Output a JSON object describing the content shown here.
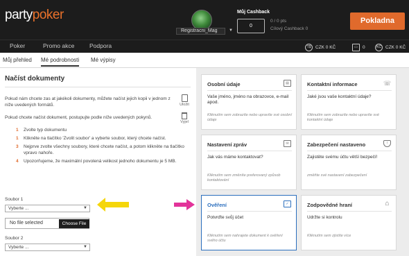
{
  "header": {
    "logo_main": "party",
    "logo_accent": "poker",
    "username": "Registracni_Mag",
    "cashback_title": "Můj Cashback",
    "cashback_value": "0",
    "cashback_pts": "0 / 0 pts",
    "cashback_total": "Cílový Cashback 0",
    "cashier_label": "Pokladna"
  },
  "nav": {
    "items": [
      "Poker",
      "Promo akce",
      "Podpora"
    ],
    "balances": [
      {
        "icon": "T$",
        "label": "CZK 0 KČ"
      },
      {
        "icon": "▭",
        "label": "0"
      },
      {
        "icon": "KČ",
        "label": "CZK 0 KČ"
      }
    ]
  },
  "subtabs": [
    "Můj přehled",
    "Mé podrobnosti",
    "Mé výpisy"
  ],
  "left": {
    "title": "Načíst dokumenty",
    "intro": "Pokud nám chcete zas at jakékoli dokumenty, můžete načíst jejich kopii v jednom z níže uvedených formátů.",
    "intro2": "Pokud chcete načíst dokument, postupujte podle níže uvedených pokynů.",
    "upload_label": "Uložit",
    "delete_label": "Vyjel",
    "steps": [
      {
        "num": "1",
        "text": "Zvolte typ dokumentu"
      },
      {
        "num": "1",
        "text": "Klikněte na tlačítko 'Zvolit soubor' a vyberte soubor, který chcete načíst."
      },
      {
        "num": "3",
        "text": "Nejprve zvolte všechny soubory, které chcete načíst, a potom klikněte na tlačítko vpravo nahoře."
      },
      {
        "num": "4",
        "text": "Upozorňujeme, že maximální povolená velikost jednoho dokumentu je 5 MB."
      }
    ],
    "file1_label": "Soubor 1",
    "file1_select": "Vyberte ...",
    "file_status": "No file selected",
    "choose_file": "Choose File",
    "file2_label": "Soubor 2",
    "file2_select": "Vyberte ..."
  },
  "cards": [
    {
      "title": "Osobní údaje",
      "icon": "id-card-icon",
      "body": "Vaše jméno, jméno na obrazovce, e-mail apod.",
      "hint": "Kliknutím sem zobrazíte nebo upravíte své osobní údaje"
    },
    {
      "title": "Kontaktní informace",
      "icon": "phone-icon",
      "body": "Jaké jsou vaše kontaktní údaje?",
      "hint": "Kliknutím sem zobrazíte nebo upravíte své kontaktní údaje"
    },
    {
      "title": "Nastavení zpráv",
      "icon": "message-settings-icon",
      "body": "Jak vás máme kontaktovat?",
      "hint": "Kliknutím sem změníte preferovaný způsob kontaktování"
    },
    {
      "title": "Zabezpečení nastaveno",
      "icon": "shield-icon",
      "body": "Zajistěte svému účtu větší bezpečí!",
      "hint": "změňte své nastavení zabezpečení"
    },
    {
      "title": "Ověření",
      "icon": "document-check-icon",
      "body": "Potvrďte svůj účet",
      "hint": "Kliknutím sem nahrajete dokument k ověření svého účtu"
    },
    {
      "title": "Zodpovědné hraní",
      "icon": "home-icon",
      "body": "Udržte si kontrolu",
      "hint": "Kliknutím sem zjistíte více"
    }
  ],
  "colors": {
    "header_bg": "#1c1c1c",
    "accent_orange": "#e06a2c",
    "highlight_blue": "#2a6ebd",
    "yellow_arrow": "#f5d60a",
    "pink_arrow": "#e2339a"
  }
}
